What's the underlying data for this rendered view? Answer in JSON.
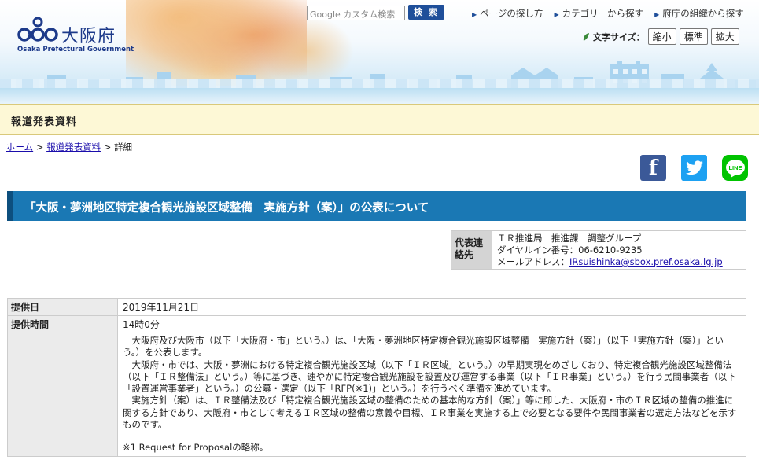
{
  "header": {
    "logo_jp": "大阪府",
    "logo_en": "Osaka Prefectural Government",
    "search_placeholder": "Google カスタム検索",
    "search_button": "検 索",
    "links": [
      "ページの探し方",
      "カテゴリーから探す",
      "府庁の組織から探す"
    ],
    "fontsize_label": "文字サイズ：",
    "fontsize_buttons": [
      "縮小",
      "標準",
      "拡大"
    ]
  },
  "pressbar": {
    "title": "報道発表資料"
  },
  "breadcrumb": {
    "home": "ホーム",
    "sep1": " > ",
    "press": "報道発表資料",
    "sep2": " > ",
    "current": "詳細"
  },
  "share": {
    "facebook": "f",
    "line": "LINE"
  },
  "title": "「大阪・夢洲地区特定複合観光施設区域整備　実施方針（案）」の公表について",
  "contact": {
    "label": "代表連絡先",
    "line1": "ＩＲ推進局　推進課　調整グループ",
    "line2": "ダイヤルイン番号：06-6210-9235",
    "line3_prefix": "メールアドレス：",
    "email": "IRsuishinka@sbox.pref.osaka.lg.jp"
  },
  "table": {
    "date_label": "提供日",
    "date_value": "2019年11月21日",
    "time_label": "提供時間",
    "time_value": "14時0分",
    "body": [
      "大阪府及び大阪市（以下「大阪府・市」という。）は、「大阪・夢洲地区特定複合観光施設区域整備　実施方針（案）」（以下「実施方針（案）」という。）を公表します。",
      "大阪府・市では、大阪・夢洲における特定複合観光施設区域（以下「ＩＲ区域」という。）の早期実現をめざしており、特定複合観光施設区域整備法（以下「ＩＲ整備法」という。）等に基づき、速やかに特定複合観光施設を設置及び運営する事業（以下「ＩＲ事業」という。）を行う民間事業者（以下「設置運営事業者」という。）の公募・選定（以下「RFP(※1)」という。）を行うべく準備を進めています。",
      "実施方針（案）は、ＩＲ整備法及び「特定複合観光施設区域の整備のための基本的な方針（案）」等に即した、大阪府・市のＩＲ区域の整備の推進に関する方針であり、大阪府・市として考えるＩＲ区域の整備の意義や目標、ＩＲ事業を実施する上で必要となる要件や民間事業者の選定方法などを示すものです。"
    ],
    "note": "※1 Request for Proposalの略称。"
  }
}
